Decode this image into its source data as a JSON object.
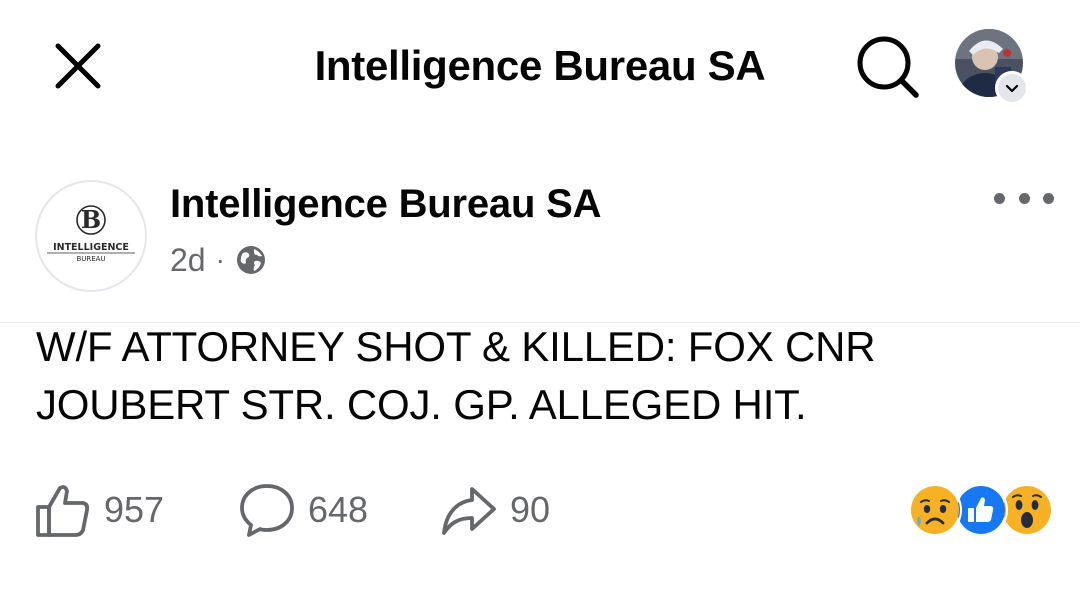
{
  "topbar": {
    "title": "Intelligence Bureau SA"
  },
  "post": {
    "author": "Intelligence Bureau SA",
    "avatar_logo": {
      "monogram": "B",
      "line1": "INTELLIGENCE",
      "line2": "BUREAU"
    },
    "time": "2d",
    "separator": "·",
    "audience_icon": "globe-icon",
    "text_line1": "W/F ATTORNEY SHOT & KILLED: FOX CNR",
    "text_line2": "JOUBERT STR. COJ. GP. ALLEGED HIT."
  },
  "actions": {
    "likes": "957",
    "comments": "648",
    "shares": "90"
  },
  "reactions": [
    "sad-reaction-icon",
    "like-reaction-icon",
    "wow-reaction-icon"
  ],
  "colors": {
    "text": "#050505",
    "secondary": "#65676b",
    "facebook_blue": "#1877f2",
    "reaction_yellow": "#f7b125"
  }
}
